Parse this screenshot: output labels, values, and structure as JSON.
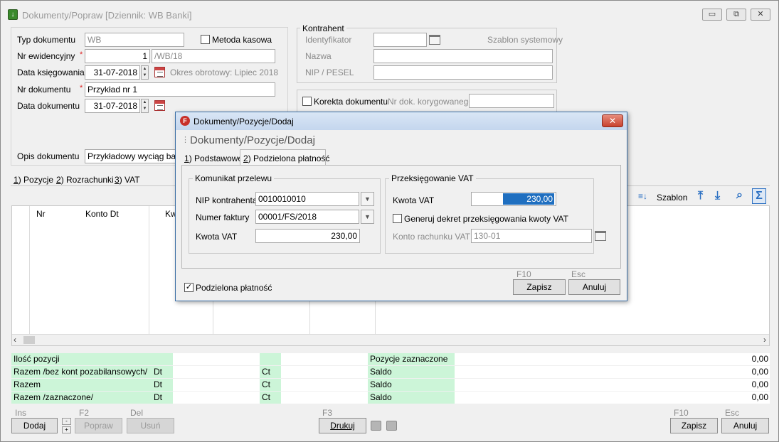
{
  "window": {
    "title": "Dokumenty/Popraw [Dziennik: WB  Banki]",
    "minimize": "▭",
    "restore": "⧉",
    "close": "✕"
  },
  "form": {
    "typ_label": "Typ dokumentu",
    "typ_value": "WB",
    "metoda_label": "Metoda kasowa",
    "nr_ewid_label": "Nr ewidencyjny",
    "nr_ewid_num": "1",
    "nr_ewid_suffix": "/WB/18",
    "data_ksieg_label": "Data księgowania",
    "data_ksieg_value": "31-07-2018",
    "okres_label": "Okres obrotowy: Lipiec 2018",
    "nr_dok_label": "Nr dokumentu",
    "nr_dok_value": "Przykład nr 1",
    "data_dok_label": "Data dokumentu",
    "data_dok_value": "31-07-2018",
    "opis_label": "Opis dokumentu",
    "opis_value": "Przykładowy wyciąg bank"
  },
  "kontrahent": {
    "title": "Kontrahent",
    "identyfikator_label": "Identyfikator",
    "szablon_label": "Szablon systemowy",
    "nazwa_label": "Nazwa",
    "nip_label": "NIP / PESEL"
  },
  "korekta": {
    "label": "Korekta dokumentu",
    "nr_label": "Nr dok. korygowanego"
  },
  "tabs": [
    {
      "key": "1",
      "rest": ") Pozycje"
    },
    {
      "key": "2",
      "rest": ") Rozrachunki"
    },
    {
      "key": "3",
      "rest": ") VAT"
    }
  ],
  "toolbar": {
    "szablon_label": "Szablon"
  },
  "grid": {
    "columns": [
      "Nr",
      "Konto Dt",
      "Kw"
    ]
  },
  "summary": {
    "rows": [
      {
        "label": "Ilość pozycji",
        "dt": "",
        "ct": "",
        "right_label": "Pozycje zaznaczone",
        "value": "0,00"
      },
      {
        "label": "Razem /bez kont pozabilansowych/",
        "dt": "Dt",
        "ct": "Ct",
        "right_label": "Saldo",
        "value": "0,00"
      },
      {
        "label": "Razem",
        "dt": "Dt",
        "ct": "Ct",
        "right_label": "Saldo",
        "value": "0,00"
      },
      {
        "label": "Razem /zaznaczone/",
        "dt": "Dt",
        "ct": "Ct",
        "right_label": "Saldo",
        "value": "0,00"
      }
    ]
  },
  "bottom": {
    "ins_key": "Ins",
    "dodaj": "Dodaj",
    "f2_key": "F2",
    "popraw": "Popraw",
    "del_key": "Del",
    "usun": "Usuń",
    "f3_key": "F3",
    "drukuj": "Drukuj",
    "f10_key": "F10",
    "zapisz": "Zapisz",
    "esc_key": "Esc",
    "anuluj": "Anuluj"
  },
  "dialog": {
    "title": "Dokumenty/Pozycje/Dodaj",
    "header": "Dokumenty/Pozycje/Dodaj",
    "tab1_key": "1",
    "tab1_rest": ") Podstawowe",
    "tab2_key": "2",
    "tab2_rest": ") Podzielona płatność",
    "komunikat": {
      "title": "Komunikat przelewu",
      "nip_label": "NIP kontrahenta",
      "nip_value": "0010010010",
      "faktura_label": "Numer faktury",
      "faktura_value": "00001/FS/2018",
      "kwota_label": "Kwota VAT",
      "kwota_value": "230,00"
    },
    "przeksieg": {
      "title": "Przeksięgowanie VAT",
      "kwota_label": "Kwota VAT",
      "kwota_value": "230,00",
      "generuj_label": "Generuj dekret przeksięgowania kwoty VAT",
      "konto_label": "Konto rachunku VAT",
      "konto_value": "130-01"
    },
    "podzielona_label": "Podzielona płatność",
    "f10_key": "F10",
    "zapisz": "Zapisz",
    "esc_key": "Esc",
    "anuluj": "Anuluj"
  }
}
